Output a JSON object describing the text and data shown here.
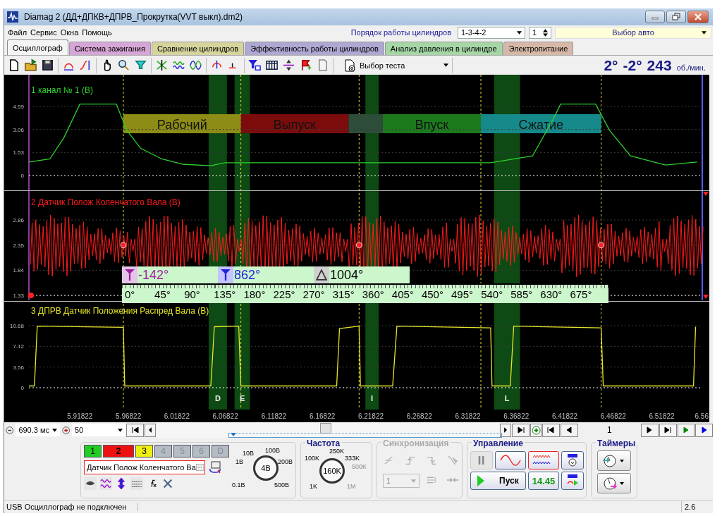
{
  "window": {
    "title": "Diamag 2 (ДД+ДПКВ+ДПРВ_Прокрутка(VVT выкл).dm2)"
  },
  "menu": [
    "Файл",
    "Сервис",
    "Окна",
    "Помощь"
  ],
  "firing_order": {
    "label": "Порядок работы цилиндров",
    "value": "1-3-4-2",
    "cylinder": "1",
    "car": "Выбор авто"
  },
  "tabs": [
    {
      "label": "Осциллограф",
      "selected": true,
      "color": "#f4f4f4"
    },
    {
      "label": "Система зажигания",
      "selected": false,
      "color": "#d6a6d6"
    },
    {
      "label": "Сравнение цилиндров",
      "selected": false,
      "color": "#d4d49c"
    },
    {
      "label": "Эффективность работы цилиндров",
      "selected": false,
      "color": "#aea8d2"
    },
    {
      "label": "Анализ давления в цилиндре",
      "selected": false,
      "color": "#a6d6a6"
    },
    {
      "label": "Электропитание",
      "selected": false,
      "color": "#d6b8a8"
    }
  ],
  "toolbar": {
    "test_select": "Выбор теста",
    "readout": {
      "angle_1": "2°",
      "angle_2": "-2°",
      "rpm": "243",
      "unit": "об./мин."
    }
  },
  "plot": {
    "panels": [
      {
        "kind": "trace",
        "title": "1 канал № 1 (В)",
        "color": "#2ed02e",
        "y_labels": [
          "4.59",
          "3.06",
          "1.53",
          "0"
        ]
      },
      {
        "kind": "waveform",
        "title": "2 Датчик Полож Коленчатого Вала (В)",
        "color": "#ff1a1a",
        "y_labels": [
          "2.86",
          "2.35",
          "1.84",
          "1.33"
        ]
      },
      {
        "kind": "chart",
        "chart_data": {
          "type": "line",
          "title": "3 ДПРВ Датчик Положения Распред Вала (В)",
          "x": [
            5.8656,
            5.8713,
            5.8742,
            5.963,
            5.9644,
            6.0532,
            6.0568,
            6.082,
            6.0842,
            6.183,
            6.1859,
            6.2061,
            6.2075,
            6.2407,
            6.2451,
            6.3418,
            6.3432,
            6.362,
            6.3656,
            6.4557,
            6.4579,
            6.551,
            6.5531
          ],
          "series": [
            {
              "color": "#e6e628",
              "values": [
                0.3,
                0.3,
                10.6,
                10.4,
                0.3,
                0.3,
                10.5,
                10.6,
                0.3,
                0.3,
                10.2,
                10.6,
                0.3,
                0.3,
                10.6,
                10.3,
                0.3,
                0.3,
                10.6,
                10.3,
                0.3,
                0.3,
                10.5
              ]
            }
          ],
          "xlim": [
            5.8656,
            6.56
          ],
          "ylim": [
            -3.76,
            14.93
          ],
          "grid": true,
          "yticks": [
            0,
            3.56,
            7.12,
            10.68
          ],
          "xticks": [
            5.91822,
            5.96822,
            6.01822,
            6.06822,
            6.11822,
            6.16822,
            6.21822,
            6.26822,
            6.31822,
            6.36822,
            6.41822,
            6.46822,
            6.51822,
            6.56
          ],
          "ref_lines": [
            {
              "axis": "x",
              "value": 5.963
            },
            {
              "axis": "x",
              "value": 6.0842
            },
            {
              "axis": "x",
              "value": 6.2061
            },
            {
              "axis": "x",
              "value": 6.3317
            },
            {
              "axis": "x",
              "value": 6.4557
            },
            {
              "axis": "y",
              "value": 0
            }
          ]
        }
      }
    ],
    "bands": [
      {
        "label": "D"
      },
      {
        "label": "E"
      },
      {
        "label": "I"
      },
      {
        "label": "L"
      }
    ],
    "phases": [
      {
        "label": "Рабочий",
        "color": "#8c8c16"
      },
      {
        "label": "Выпуск",
        "color": "#7c0c0c"
      },
      {
        "color": "#2e4c3a"
      },
      {
        "label": "Впуск",
        "color": "#1c7a1c"
      },
      {
        "label": "Сжатие",
        "color": "#168a8a"
      }
    ],
    "ruler": {
      "readouts": [
        {
          "kind": "start",
          "value": "-142°"
        },
        {
          "kind": "end",
          "value": "862°"
        },
        {
          "kind": "delta",
          "value": "1004°"
        }
      ],
      "degrees": [
        "0°",
        "45°",
        "90°",
        "135°",
        "180°",
        "225°",
        "270°",
        "315°",
        "360°",
        "405°",
        "450°",
        "495°",
        "540°",
        "585°",
        "630°",
        "675°"
      ]
    }
  },
  "navigation": {
    "time_scale": "690.3 мс",
    "zoom": "50",
    "frame": "1"
  },
  "controls": {
    "channels": [
      {
        "label": "1",
        "color": "#22cc22",
        "enabled": true,
        "selected": false
      },
      {
        "label": "2",
        "color": "#ee1111",
        "enabled": true,
        "selected": true
      },
      {
        "label": "3",
        "color": "#eeee11",
        "enabled": true,
        "selected": false
      },
      {
        "label": "4",
        "color": "#b4bcc4",
        "enabled": false,
        "selected": false
      },
      {
        "label": "5",
        "color": "#b4bcc4",
        "enabled": false,
        "selected": false
      },
      {
        "label": "6",
        "color": "#b4bcc4",
        "enabled": false,
        "selected": false
      },
      {
        "label": "D",
        "color": "#b4bcc4",
        "enabled": false,
        "selected": false
      }
    ],
    "channel_name": "Датчик Полож Коленчатого Ва",
    "voltage": {
      "scale": [
        {
          "label": "10В",
          "enabled": true
        },
        {
          "label": "100В",
          "enabled": true
        },
        {
          "label": "1В",
          "enabled": true
        },
        {
          "label": "200В",
          "enabled": true
        },
        {
          "label": "0.1В",
          "enabled": true
        },
        {
          "label": "500В",
          "enabled": true
        }
      ],
      "value": "4В"
    },
    "frequency": {
      "title": "Частота",
      "scale": [
        {
          "label": "250K",
          "enabled": true
        },
        {
          "label": "100K",
          "enabled": true
        },
        {
          "label": "333K",
          "enabled": true
        },
        {
          "label": "500K",
          "enabled": false
        },
        {
          "label": "1K",
          "enabled": true
        },
        {
          "label": "1M",
          "enabled": false
        }
      ],
      "value": "160K"
    },
    "sync": {
      "title": "Синхронизация",
      "enabled": false,
      "channel": "1"
    },
    "control": {
      "title": "Управление",
      "start": "Пуск",
      "time": "14.45"
    },
    "timers": {
      "title": "Таймеры"
    }
  },
  "status_bar": [
    "USB Осциллограф не подключен",
    "2.6"
  ]
}
